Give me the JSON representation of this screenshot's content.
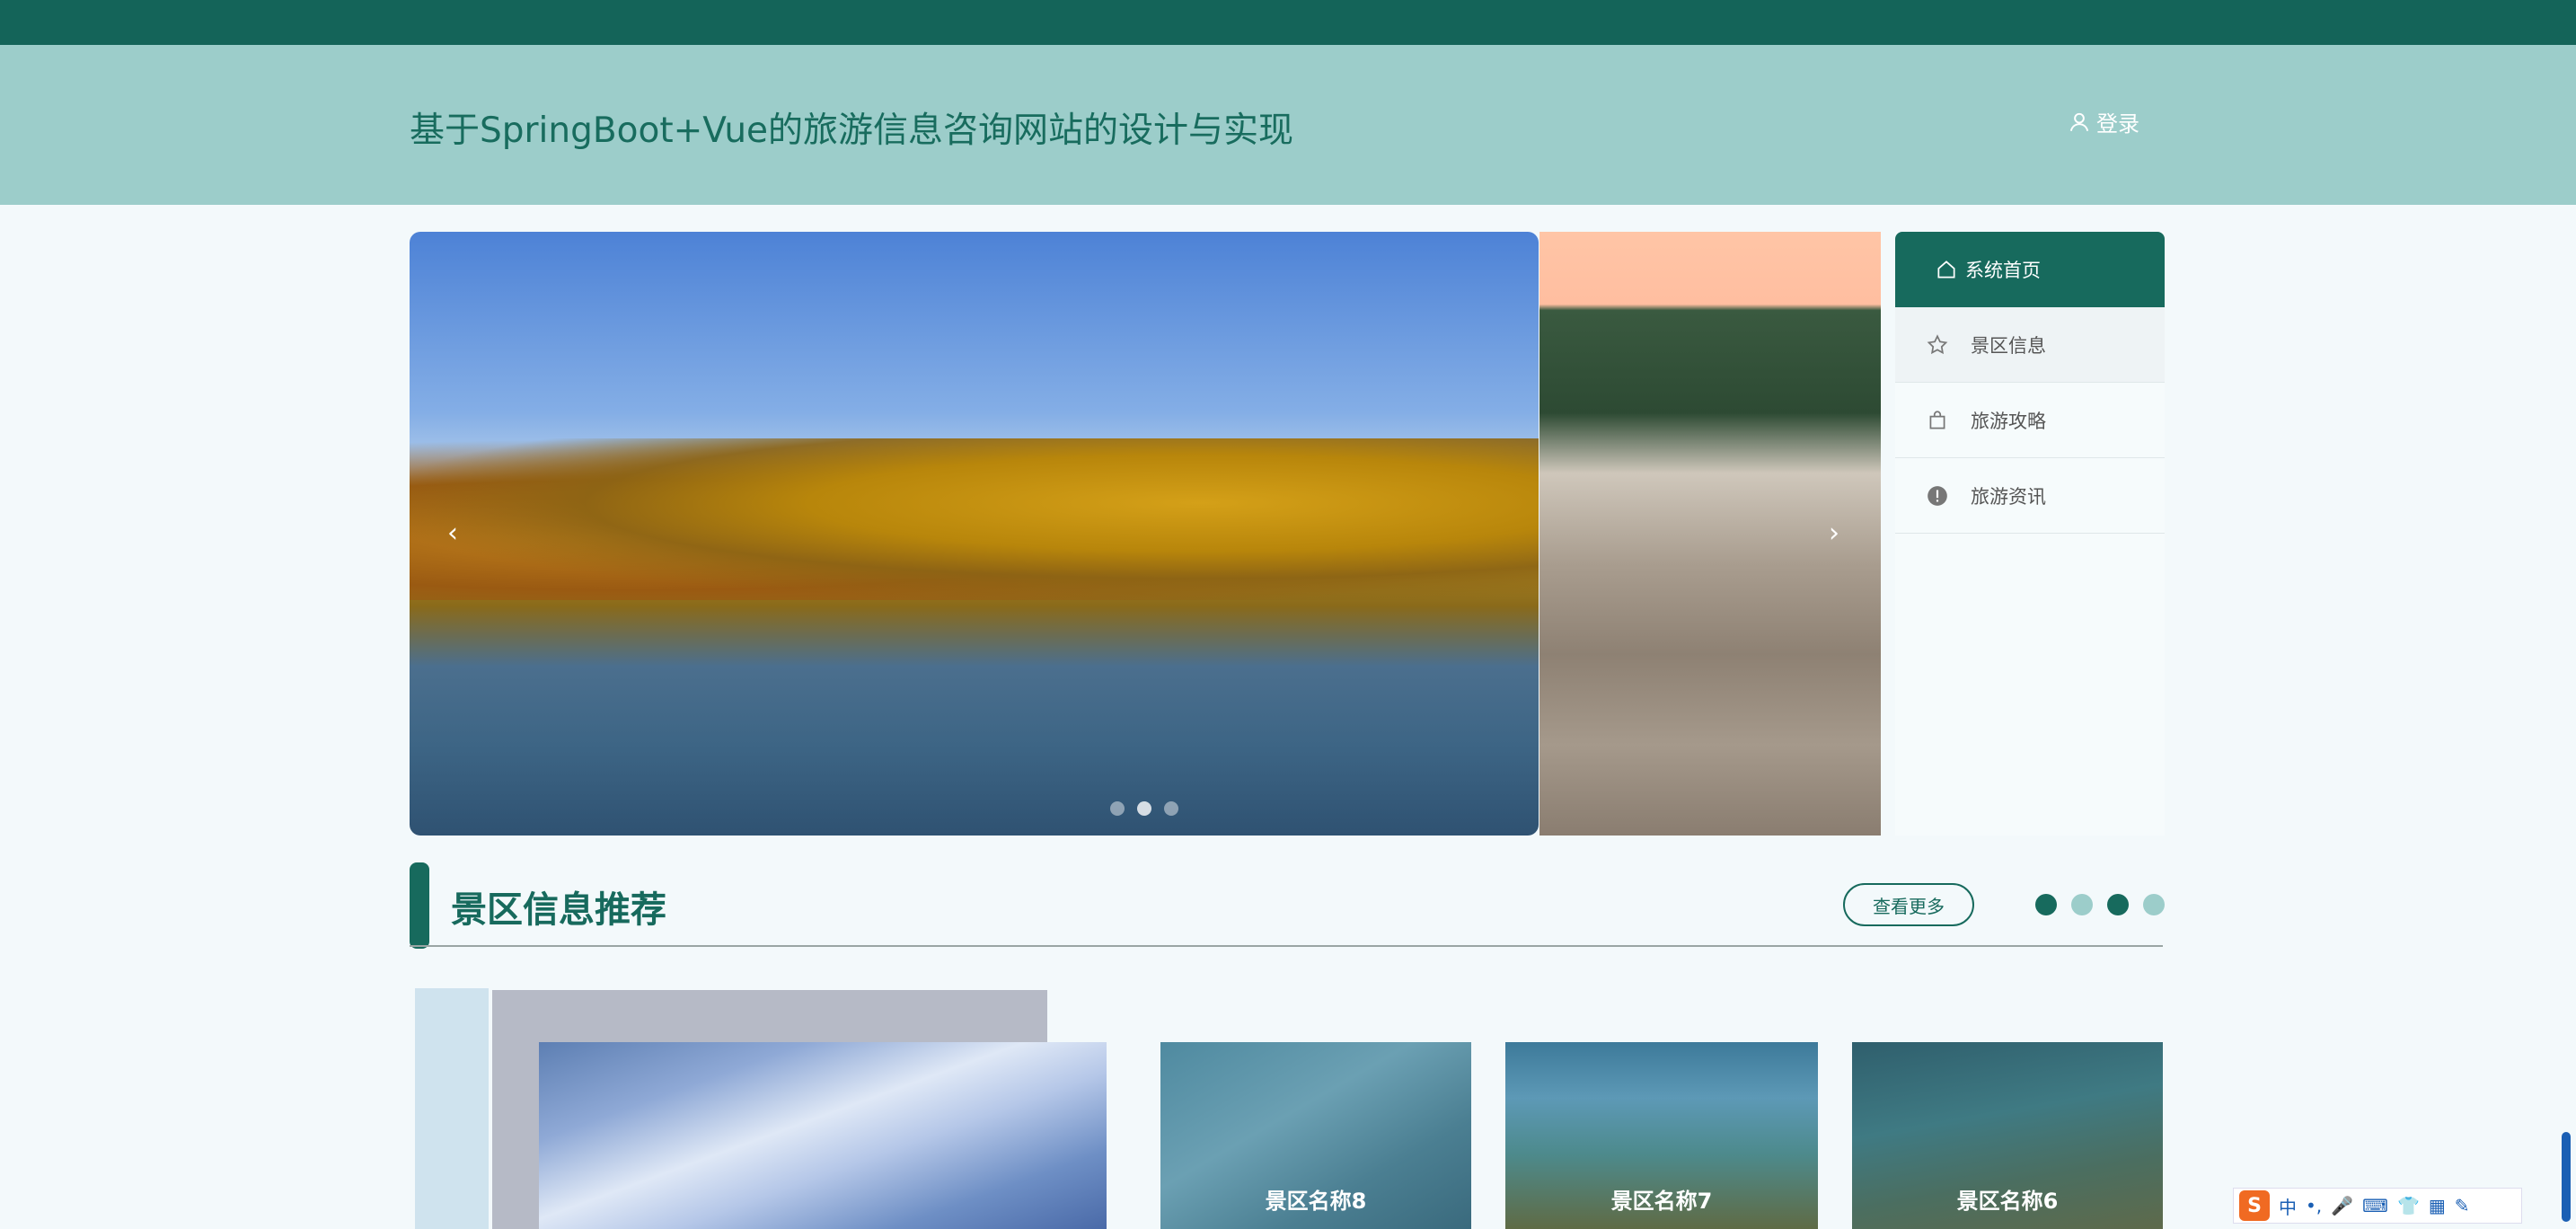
{
  "header": {
    "title": "基于SpringBoot+Vue的旅游信息咨询网站的设计与实现",
    "login_label": "登录"
  },
  "carousel": {
    "prev_symbol": "‹",
    "next_symbol": "›",
    "dot_count": 3,
    "active_dot": 1
  },
  "menu": {
    "items": [
      {
        "label": "系统首页",
        "icon": "home-icon"
      },
      {
        "label": "景区信息",
        "icon": "star-icon"
      },
      {
        "label": "旅游攻略",
        "icon": "bag-icon"
      },
      {
        "label": "旅游资讯",
        "icon": "info-circle-icon"
      }
    ]
  },
  "section": {
    "title": "景区信息推荐",
    "more_label": "查看更多"
  },
  "cards": [
    {
      "label": "景区名称8"
    },
    {
      "label": "景区名称7"
    },
    {
      "label": "景区名称6"
    }
  ],
  "ime": {
    "logo": "S",
    "items": [
      "中",
      "•,",
      "🎤",
      "⌨",
      "👕",
      "▦",
      "✎"
    ]
  },
  "colors": {
    "brand_dark": "#176a5d",
    "brand_light": "#9ccdca",
    "topbar": "#146459"
  }
}
